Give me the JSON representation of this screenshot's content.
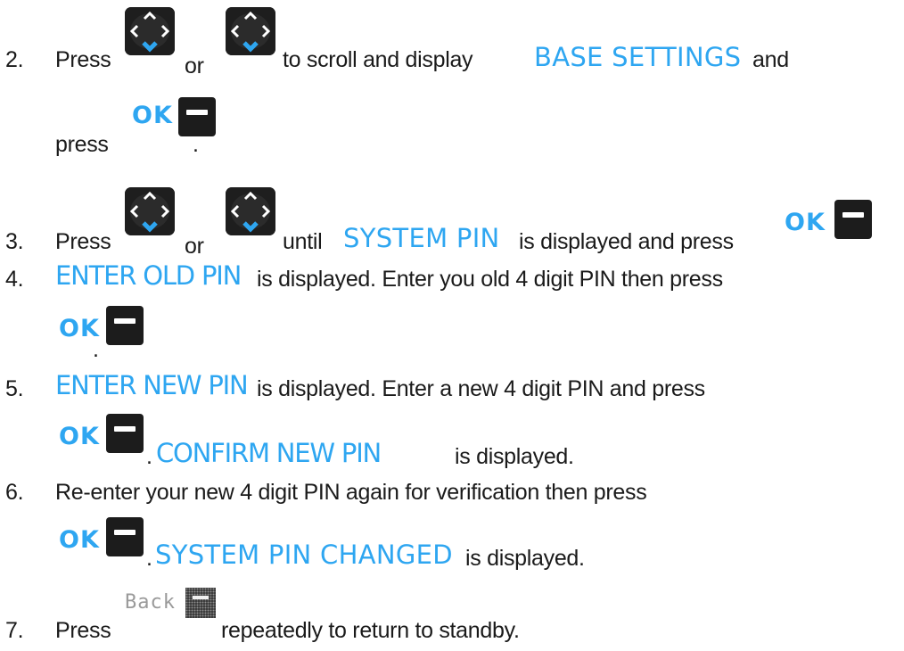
{
  "step2": {
    "num": "2.",
    "press": "Press",
    "or": "or",
    "text_a": "to scroll and display",
    "term": "BASE SETTINGS",
    "text_b": "and",
    "press2": "press",
    "period": "."
  },
  "step3": {
    "num": "3.",
    "press": "Press",
    "or": "or",
    "text_a": "until",
    "term": "SYSTEM PIN",
    "text_b": "is displayed and press"
  },
  "step4": {
    "num": "4.",
    "term": "ENTER OLD PIN",
    "text": "is displayed.  Enter you old 4 digit PIN then press",
    "period": "."
  },
  "step5": {
    "num": "5.",
    "term": "ENTER NEW PIN",
    "text": "is displayed.  Enter a new 4 digit PIN and press",
    "period": ".",
    "term2": "CONFIRM NEW PIN",
    "text2": "is displayed."
  },
  "step6": {
    "num": "6.",
    "text": "Re-enter your new 4 digit PIN again for verification then press",
    "period": ".",
    "term": "SYSTEM PIN CHANGED",
    "text2": "is displayed."
  },
  "step7": {
    "num": "7.",
    "press": "Press",
    "back_label": "Back",
    "text": "repeatedly to return to standby."
  },
  "icons": {
    "ok_label": "OK",
    "nav_key": "nav-key-icon",
    "ok_key": "ok-minus-key-icon",
    "back_key": "back-key-icon"
  },
  "colors": {
    "accent": "#2ea6f1",
    "text": "#1a1a1a",
    "key": "#1e1e1e"
  }
}
